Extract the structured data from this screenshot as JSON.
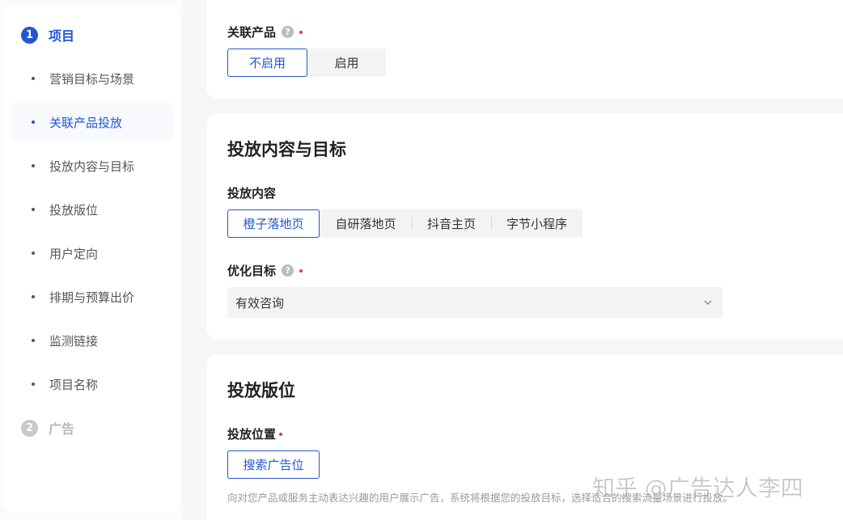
{
  "sidebar": {
    "steps": [
      {
        "num": "1",
        "label": "项目"
      },
      {
        "num": "2",
        "label": "广告"
      }
    ],
    "items": [
      {
        "label": "营销目标与场景"
      },
      {
        "label": "关联产品投放"
      },
      {
        "label": "投放内容与目标"
      },
      {
        "label": "投放版位"
      },
      {
        "label": "用户定向"
      },
      {
        "label": "排期与预算出价"
      },
      {
        "label": "监测链接"
      },
      {
        "label": "项目名称"
      }
    ],
    "selected_index": 1
  },
  "related_product": {
    "label": "关联产品",
    "options": [
      "不启用",
      "启用"
    ],
    "selected": "不启用"
  },
  "content_section": {
    "title": "投放内容与目标",
    "content_label": "投放内容",
    "content_options": [
      "橙子落地页",
      "自研落地页",
      "抖音主页",
      "字节小程序"
    ],
    "content_selected": "橙子落地页",
    "goal_label": "优化目标",
    "goal_value": "有效咨询"
  },
  "placement_section": {
    "title": "投放版位",
    "position_label": "投放位置",
    "position_button": "搜索广告位",
    "hint": "向对您产品或服务主动表达兴趣的用户展示广告，系统将根据您的投放目标，选择适合的搜索流量场景进行投放。"
  },
  "icons": {
    "help": "?",
    "chevron": "chevron-down-icon"
  },
  "colors": {
    "accent": "#2355d2",
    "required": "#e03a3a"
  },
  "watermark": "知乎 @广告达人李四"
}
